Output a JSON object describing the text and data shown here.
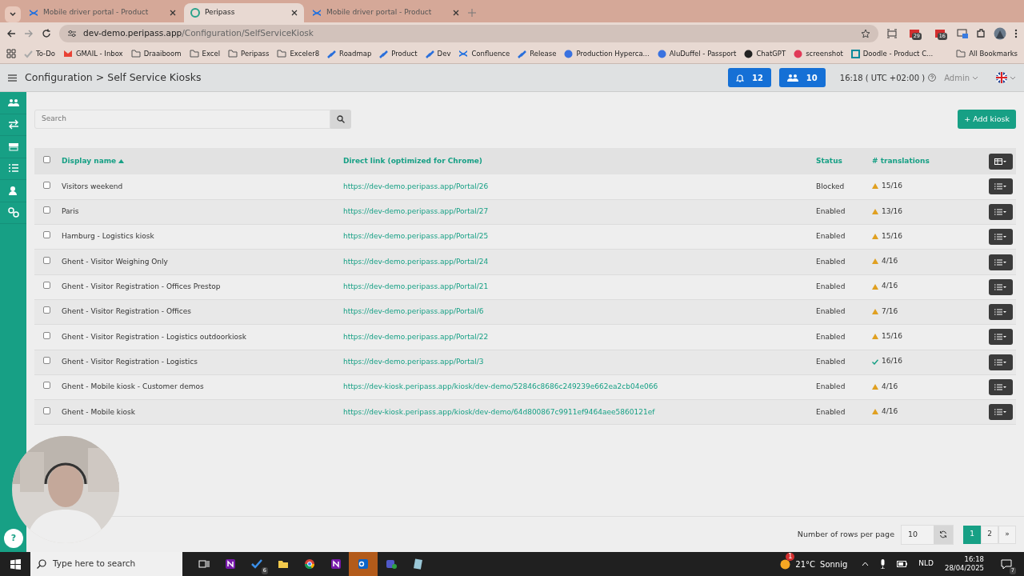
{
  "browser": {
    "tabs": [
      {
        "title": "Mobile driver portal - Product",
        "selected": false
      },
      {
        "title": "Peripass",
        "selected": true
      },
      {
        "title": "Mobile driver portal - Product",
        "selected": false
      }
    ],
    "address": {
      "host": "dev-demo.peripass.app",
      "path": "/Configuration/SelfServiceKiosk"
    },
    "extension_badges": [
      "29",
      "16"
    ],
    "bookmarks": [
      "To-Do",
      "GMAIL - Inbox",
      "Draaiboom",
      "Excel",
      "Peripass",
      "Exceler8",
      "Roadmap",
      "Product",
      "Dev",
      "Confluence",
      "Release",
      "Production Hyperca...",
      "AluDuffel - Passport",
      "ChatGPT",
      "screenshot",
      "Doodle - Product C..."
    ],
    "all_bookmarks": "All Bookmarks"
  },
  "header": {
    "breadcrumb": "Configuration > Self Service Kiosks",
    "notifications": "12",
    "users": "10",
    "time": "16:18 ( UTC +02:00 )",
    "user": "Admin"
  },
  "search": {
    "placeholder": "Search"
  },
  "add_button": "+ Add kiosk",
  "table": {
    "select_all_checked": false,
    "columns": [
      {
        "label": "Display name",
        "sorted": true
      },
      {
        "label": "Direct link (optimized for Chrome)"
      },
      {
        "label": "Status"
      },
      {
        "label": "# translations"
      }
    ],
    "rows": [
      {
        "checked": false,
        "name": "Visitors weekend",
        "link": "https://dev-demo.peripass.app/Portal/26",
        "status": "Blocked",
        "translations": "15/16",
        "complete": false
      },
      {
        "checked": false,
        "name": "Paris",
        "link": "https://dev-demo.peripass.app/Portal/27",
        "status": "Enabled",
        "translations": "13/16",
        "complete": false
      },
      {
        "checked": false,
        "name": "Hamburg - Logistics kiosk",
        "link": "https://dev-demo.peripass.app/Portal/25",
        "status": "Enabled",
        "translations": "15/16",
        "complete": false
      },
      {
        "checked": false,
        "name": "Ghent - Visitor Weighing Only",
        "link": "https://dev-demo.peripass.app/Portal/24",
        "status": "Enabled",
        "translations": "4/16",
        "complete": false
      },
      {
        "checked": false,
        "name": "Ghent - Visitor Registration - Offices Prestop",
        "link": "https://dev-demo.peripass.app/Portal/21",
        "status": "Enabled",
        "translations": "4/16",
        "complete": false
      },
      {
        "checked": false,
        "name": "Ghent - Visitor Registration - Offices",
        "link": "https://dev-demo.peripass.app/Portal/6",
        "status": "Enabled",
        "translations": "7/16",
        "complete": false
      },
      {
        "checked": false,
        "name": "Ghent - Visitor Registration - Logistics outdoorkiosk",
        "link": "https://dev-demo.peripass.app/Portal/22",
        "status": "Enabled",
        "translations": "15/16",
        "complete": false
      },
      {
        "checked": false,
        "name": "Ghent - Visitor Registration - Logistics",
        "link": "https://dev-demo.peripass.app/Portal/3",
        "status": "Enabled",
        "translations": "16/16",
        "complete": true
      },
      {
        "checked": false,
        "name": "Ghent - Mobile kiosk - Customer demos",
        "link": "https://dev-kiosk.peripass.app/kiosk/dev-demo/52846c8686c249239e662ea2cb04e066",
        "status": "Enabled",
        "translations": "4/16",
        "complete": false
      },
      {
        "checked": false,
        "name": "Ghent - Mobile kiosk",
        "link": "https://dev-kiosk.peripass.app/kiosk/dev-demo/64d800867c9911ef9464aee5860121ef",
        "status": "Enabled",
        "translations": "4/16",
        "complete": false
      }
    ]
  },
  "pagination": {
    "rows_label": "Number of rows per page",
    "rows_value": "10",
    "pages": [
      {
        "label": "1",
        "selected": true
      },
      {
        "label": "2",
        "selected": false
      }
    ],
    "next": "»"
  },
  "help": "?",
  "taskbar": {
    "search_placeholder": "Type here to search",
    "todo_badge": "6",
    "temperature": "21°C",
    "condition": "Sonnig",
    "weather_badge": "1",
    "language": "NLD",
    "time": "16:18",
    "date": "28/04/2025",
    "notifications": "7"
  }
}
